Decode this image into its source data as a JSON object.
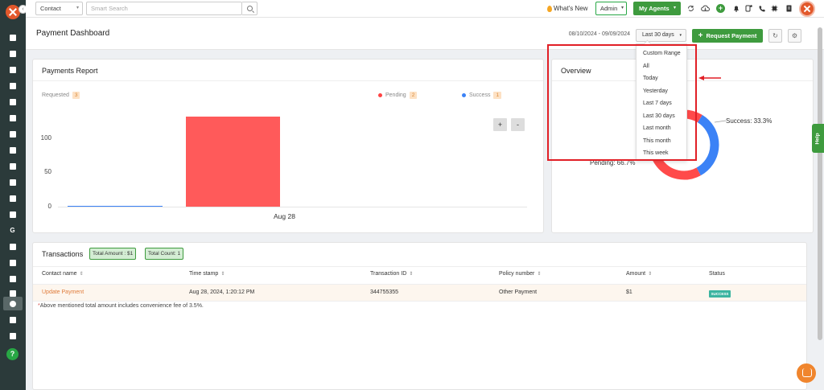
{
  "topbar": {
    "search_scope": "Contact",
    "search_placeholder": "Smart Search",
    "whats_new": "What's New",
    "role": "Admin",
    "my_agents": "My Agents"
  },
  "page": {
    "title": "Payment Dashboard",
    "date_range": "08/10/2024 - 09/09/2024",
    "period_button": "Last 30 days",
    "request_payment": "Request Payment"
  },
  "period_dropdown": {
    "options": [
      "Custom Range",
      "All",
      "Today",
      "Yesterday",
      "Last 7 days",
      "Last 30 days",
      "Last month",
      "This month",
      "This week"
    ]
  },
  "payments_report": {
    "title": "Payments Report",
    "legend": {
      "requested_label": "Requested",
      "requested_count": "3",
      "pending_label": "Pending",
      "pending_count": "2",
      "success_label": "Success",
      "success_count": "1"
    },
    "zoom_in": "+",
    "zoom_out": "-"
  },
  "overview": {
    "title": "Overview",
    "success_label": "Success: 33.3%",
    "pending_label": "Pending: 66.7%"
  },
  "transactions": {
    "title": "Transactions",
    "total_amount": "Total Amount : $1",
    "total_count": "Total Count: 1",
    "columns": [
      "Contact name",
      "Time stamp",
      "Transaction ID",
      "Policy number",
      "Amount",
      "Status"
    ],
    "rows": [
      {
        "contact": "Update Payment",
        "timestamp": "Aug 28, 2024, 1:20:12 PM",
        "transaction_id": "344755355",
        "policy": "Other Payment",
        "amount": "$1",
        "status": "SUCCESS"
      }
    ],
    "note_mark": "*",
    "note": "Above mentioned total amount includes convenience fee of 3.5%."
  },
  "help_tab": "Help",
  "colors": {
    "accent_green": "#3e9b3e",
    "pending_red": "#ff5a5a",
    "success_blue": "#3b82f6",
    "highlight_red": "#e11f26",
    "sidebar": "#2b3a3a",
    "brand_orange": "#e2582b"
  },
  "chart_data": [
    {
      "type": "bar",
      "title": "Payments Report",
      "categories": [
        "Aug 28"
      ],
      "series": [
        {
          "name": "Success",
          "values": [
            1
          ],
          "color": "#3b82f6"
        },
        {
          "name": "Pending",
          "values": [
            131
          ],
          "color": "#ff5a5a"
        }
      ],
      "yticks": [
        0,
        50,
        100
      ],
      "ylim": [
        0,
        140
      ],
      "grid": false,
      "legend": "top"
    },
    {
      "type": "pie",
      "title": "Overview",
      "style": "donut",
      "labels": [
        "Success",
        "Pending"
      ],
      "values": [
        33.3,
        66.7
      ],
      "colors": [
        "#3b82f6",
        "#ff4a4a"
      ]
    }
  ]
}
